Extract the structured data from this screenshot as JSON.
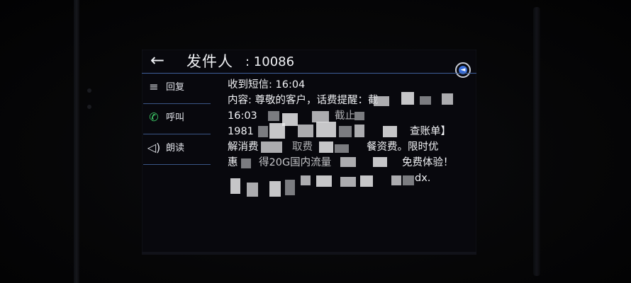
{
  "header": {
    "back_icon": "←",
    "title_label": "发件人",
    "title_number": ": 10086",
    "reply_icon": "◄"
  },
  "sidebar": {
    "items": [
      {
        "label": "回复",
        "icon": "message-icon",
        "glyph": "≡"
      },
      {
        "label": "呼叫",
        "icon": "phone-icon",
        "glyph": "✆"
      },
      {
        "label": "朗读",
        "icon": "speaker-icon",
        "glyph": "◁)"
      }
    ]
  },
  "message": {
    "received": "收到短信: 16:04",
    "content_line1": "内容: 尊敬的客户，话费提醒：截",
    "content_line2": "16:03",
    "content_line2_tail": "截止",
    "content_line3": "1981",
    "content_line3_tail": "查账单】",
    "content_line4_a": "解消费",
    "content_line4_b": "取费",
    "content_line4_c": "餐资费。限时优",
    "content_line5_a": "惠",
    "content_line5_b": "得20G国内流量",
    "content_line5_c": "免费体验！",
    "content_line6_tail": "dx."
  },
  "colors": {
    "accent_line": "#3f5f9a",
    "call_icon": "#3fcf6a",
    "reply_badge": "#3a6ed8"
  }
}
